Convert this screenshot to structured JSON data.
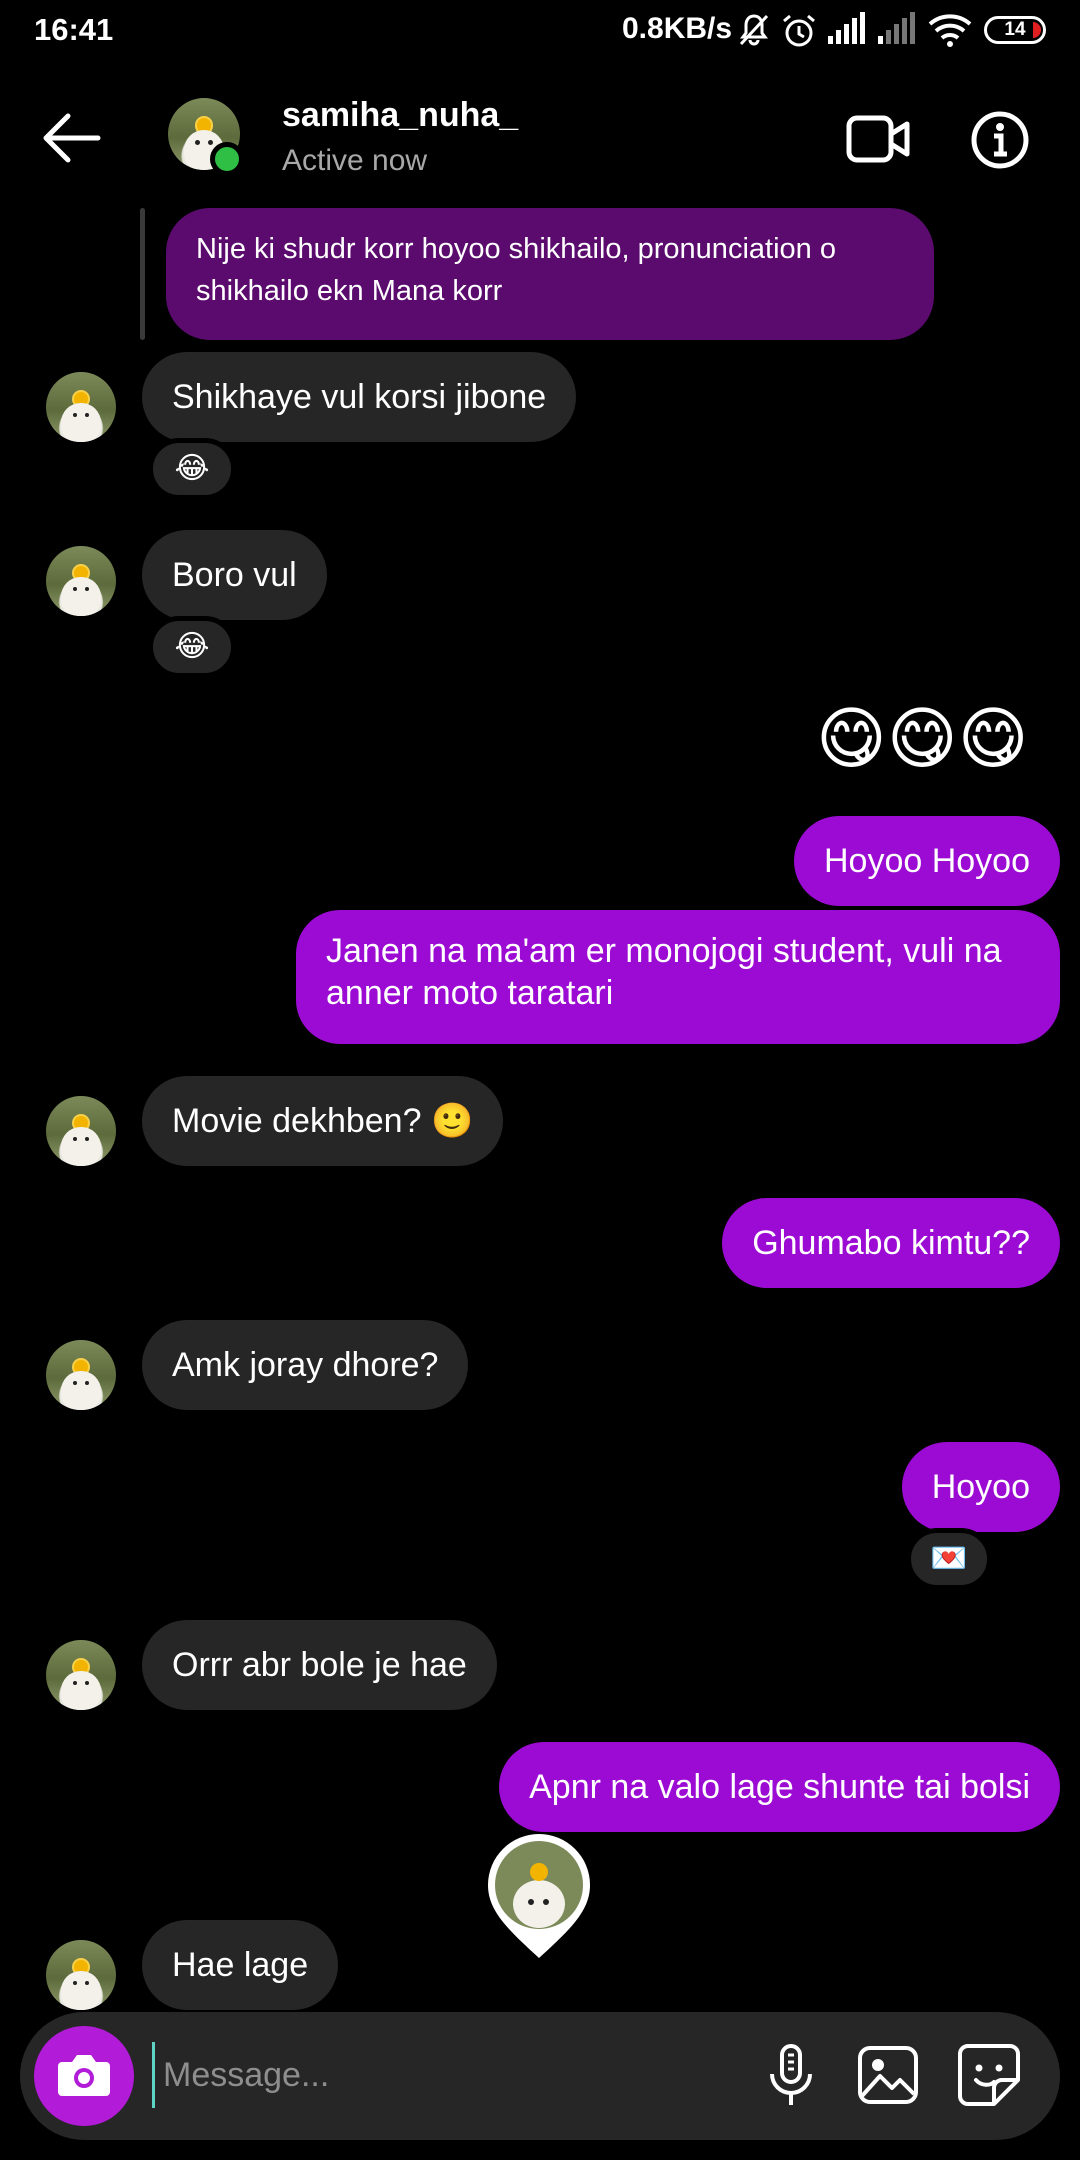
{
  "status_bar": {
    "time": "16:41",
    "net_speed": "0.8KB/s",
    "battery": "14"
  },
  "header": {
    "username": "samiha_nuha_",
    "status": "Active now"
  },
  "messages": {
    "m0": "Nije ki shudr korr hoyoo shikhailo, pronunciation o shikhailo ekn Mana korr",
    "m1": "Shikhaye vul korsi jibone",
    "m2": "Boro vul",
    "m3": "😋😋😋",
    "m4": "Hoyoo Hoyoo",
    "m5": "Janen na ma'am er monojogi student, vuli na anner moto taratari",
    "m6": "Movie dekhben? 🙂",
    "m7": "Ghumabo kimtu??",
    "m8": "Amk joray dhore?",
    "m9": "Hoyoo",
    "m10": "Orrr abr bole je hae",
    "m11": "Apnr na valo lage shunte tai bolsi",
    "m12": "Hae lage"
  },
  "reactions": {
    "r1": "😂",
    "r2": "😂",
    "r9": "💌"
  },
  "composer": {
    "placeholder": "Message..."
  },
  "colors": {
    "outgoing_bubble": "#9c0bd4",
    "incoming_bubble": "#262626",
    "camera_button": "#b21bd8",
    "online_dot": "#2fbf45"
  }
}
